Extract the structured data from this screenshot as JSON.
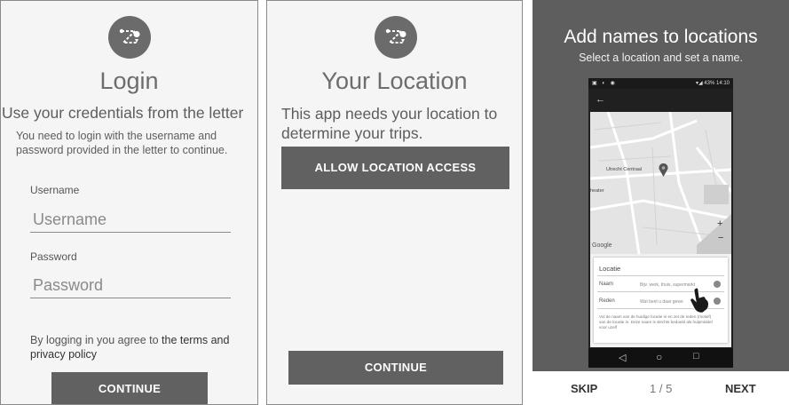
{
  "login": {
    "title": "Login",
    "subtitle": "Use your credentials from the letter",
    "instructions": "You need to login with the username and password provided in the letter to continue.",
    "username_label": "Username",
    "username_placeholder": "Username",
    "password_label": "Password",
    "password_placeholder": "Password",
    "agree_prefix": "By logging in you agree to ",
    "agree_link": "the terms and privacy policy",
    "continue_label": "CONTINUE"
  },
  "location": {
    "title": "Your Location",
    "description": "This app needs your location to determine your trips.",
    "allow_label": "ALLOW LOCATION ACCESS",
    "continue_label": "CONTINUE"
  },
  "tutorial": {
    "title": "Add names to locations",
    "subtitle": "Select a location and set a name.",
    "phone": {
      "time": "14:10",
      "battery": "43%",
      "back_arrow": "←",
      "map_labels": {
        "station": "Utrecht Centraal",
        "theater": "heater",
        "google": "Google",
        "zoom_in": "+",
        "zoom_out": "−"
      },
      "card": {
        "header": "Locatie",
        "name_label": "Naam",
        "name_placeholder": "Bijv. werk, thuis, supermarkt",
        "reason_label": "Reden",
        "reason_placeholder": "Wat bent u daar gewe",
        "help": "Vul de naam van de huidige locatie in en zet de reden (motief) van de locatie in. Deze naam is slechts bedoeld als hulpmiddel voor uzelf"
      },
      "nav": {
        "back": "◁",
        "home": "○",
        "recent": "□"
      }
    },
    "skip_label": "SKIP",
    "page_indicator": "1 / 5",
    "next_label": "NEXT"
  }
}
